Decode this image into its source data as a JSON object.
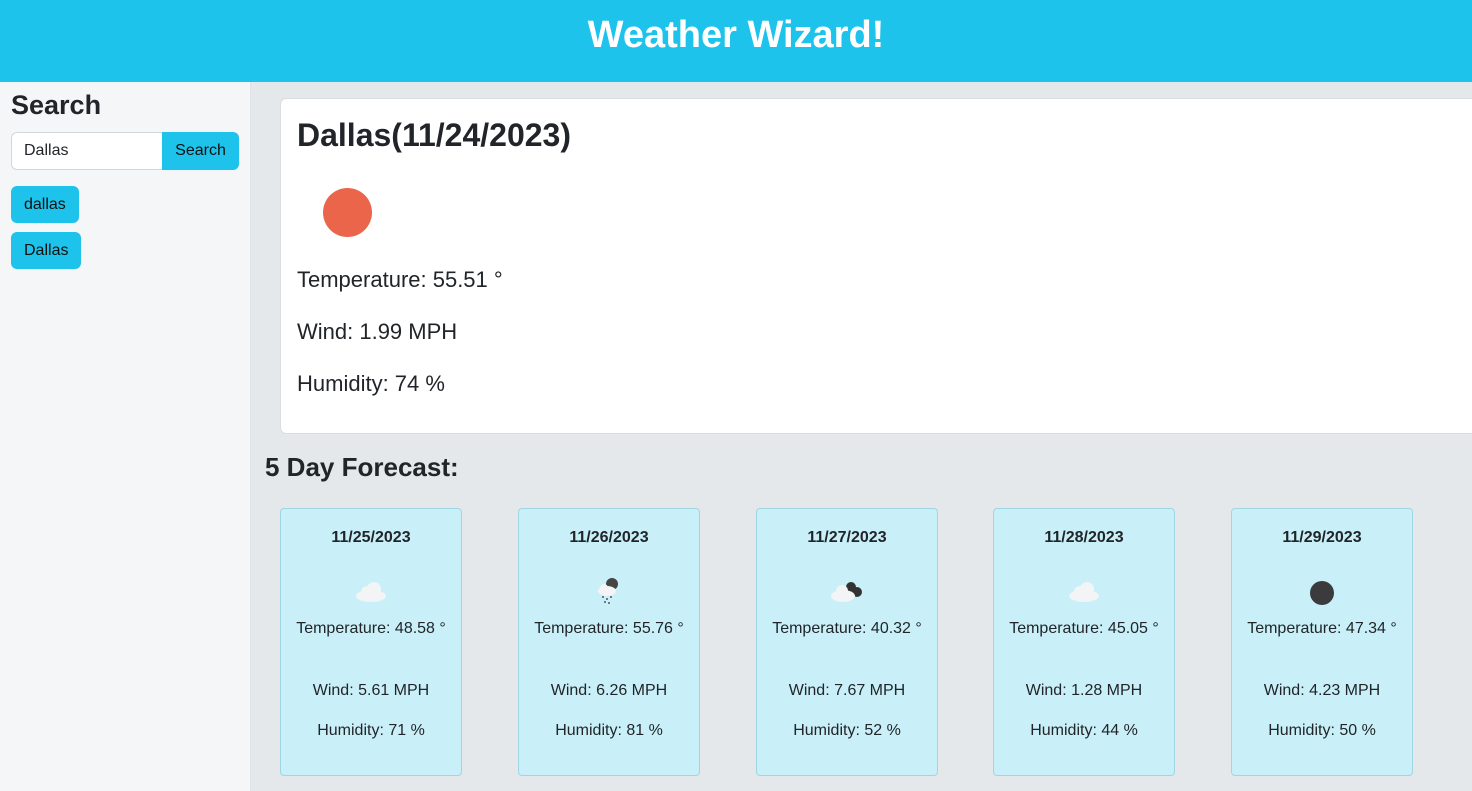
{
  "header": {
    "title": "Weather Wizard!"
  },
  "sidebar": {
    "heading": "Search",
    "search": {
      "value": "Dallas",
      "button_label": "Search"
    },
    "history": [
      "dallas",
      "Dallas"
    ]
  },
  "current": {
    "title": "Dallas(11/24/2023)",
    "icon": "sun-icon",
    "temperature": "Temperature: 55.51 °",
    "wind": "Wind: 1.99 MPH",
    "humidity": "Humidity: 74 %"
  },
  "forecast": {
    "title": "5 Day Forecast:",
    "days": [
      {
        "date": "11/25/2023",
        "icon": "cloud-icon",
        "temperature": "Temperature: 48.58 °",
        "wind": "Wind: 5.61 MPH",
        "humidity": "Humidity: 71 %"
      },
      {
        "date": "11/26/2023",
        "icon": "rain-cloud-icon",
        "temperature": "Temperature: 55.76 °",
        "wind": "Wind: 6.26 MPH",
        "humidity": "Humidity: 81 %"
      },
      {
        "date": "11/27/2023",
        "icon": "broken-clouds-icon",
        "temperature": "Temperature: 40.32 °",
        "wind": "Wind: 7.67 MPH",
        "humidity": "Humidity: 52 %"
      },
      {
        "date": "11/28/2023",
        "icon": "cloud-icon",
        "temperature": "Temperature: 45.05 °",
        "wind": "Wind: 1.28 MPH",
        "humidity": "Humidity: 44 %"
      },
      {
        "date": "11/29/2023",
        "icon": "dark-circle-icon",
        "temperature": "Temperature: 47.34 °",
        "wind": "Wind: 4.23 MPH",
        "humidity": "Humidity: 50 %"
      }
    ]
  },
  "colors": {
    "accent": "#1dc3ea",
    "card_bg": "#c9f0f8",
    "sun": "#eb654a"
  }
}
